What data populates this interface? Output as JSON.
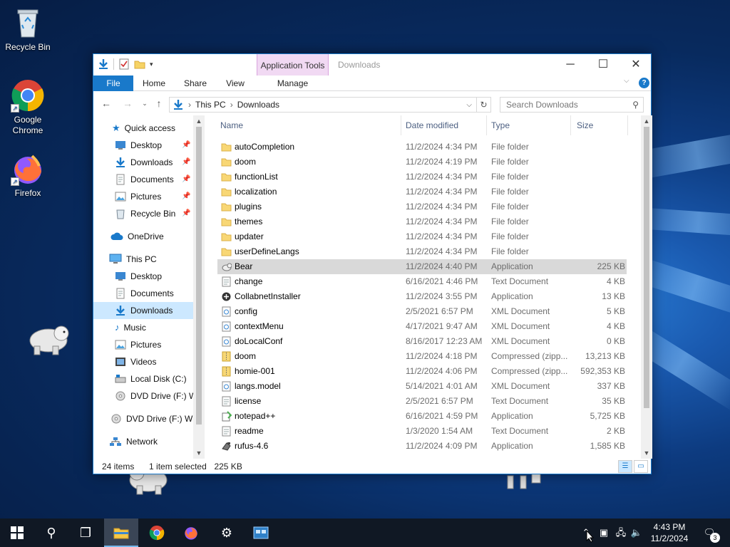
{
  "desktop": {
    "icons": [
      {
        "label": "Recycle Bin",
        "icon": "recycle-bin-icon"
      },
      {
        "label": "Google Chrome",
        "icon": "chrome-icon"
      },
      {
        "label": "Firefox",
        "icon": "firefox-icon"
      }
    ]
  },
  "window": {
    "title": "Downloads",
    "context_tab": "Application Tools",
    "ribbon_tabs": [
      "File",
      "Home",
      "Share",
      "View",
      "Manage"
    ],
    "breadcrumb": [
      "This PC",
      "Downloads"
    ],
    "search_placeholder": "Search Downloads",
    "accent": "#1979ca"
  },
  "nav": {
    "items": [
      {
        "label": "Quick access",
        "icon": "star-icon"
      },
      {
        "label": "Desktop",
        "icon": "desktop-folder-icon",
        "pinned": true
      },
      {
        "label": "Downloads",
        "icon": "download-arrow-icon",
        "pinned": true
      },
      {
        "label": "Documents",
        "icon": "documents-icon",
        "pinned": true
      },
      {
        "label": "Pictures",
        "icon": "pictures-icon",
        "pinned": true
      },
      {
        "label": "Recycle Bin",
        "icon": "recycle-bin-icon",
        "pinned": true
      },
      {
        "label": "OneDrive",
        "icon": "cloud-icon"
      },
      {
        "label": "This PC",
        "icon": "computer-icon"
      },
      {
        "label": "Desktop",
        "icon": "desktop-folder-icon"
      },
      {
        "label": "Documents",
        "icon": "documents-icon"
      },
      {
        "label": "Downloads",
        "icon": "download-arrow-icon",
        "selected": true
      },
      {
        "label": "Music",
        "icon": "music-icon"
      },
      {
        "label": "Pictures",
        "icon": "pictures-icon"
      },
      {
        "label": "Videos",
        "icon": "videos-icon"
      },
      {
        "label": "Local Disk (C:)",
        "icon": "disk-icon"
      },
      {
        "label": "DVD Drive (F:) W",
        "icon": "dvd-icon"
      },
      {
        "label": "DVD Drive (F:) WIN",
        "icon": "dvd-icon"
      },
      {
        "label": "Network",
        "icon": "network-icon"
      }
    ]
  },
  "columns": {
    "name": "Name",
    "date": "Date modified",
    "type": "Type",
    "size": "Size"
  },
  "files": [
    {
      "name": "autoCompletion",
      "date": "11/2/2024 4:34 PM",
      "type": "File folder",
      "size": "",
      "icon": "folder-icon"
    },
    {
      "name": "doom",
      "date": "11/2/2024 4:19 PM",
      "type": "File folder",
      "size": "",
      "icon": "folder-icon"
    },
    {
      "name": "functionList",
      "date": "11/2/2024 4:34 PM",
      "type": "File folder",
      "size": "",
      "icon": "folder-icon"
    },
    {
      "name": "localization",
      "date": "11/2/2024 4:34 PM",
      "type": "File folder",
      "size": "",
      "icon": "folder-icon"
    },
    {
      "name": "plugins",
      "date": "11/2/2024 4:34 PM",
      "type": "File folder",
      "size": "",
      "icon": "folder-icon"
    },
    {
      "name": "themes",
      "date": "11/2/2024 4:34 PM",
      "type": "File folder",
      "size": "",
      "icon": "folder-icon"
    },
    {
      "name": "updater",
      "date": "11/2/2024 4:34 PM",
      "type": "File folder",
      "size": "",
      "icon": "folder-icon"
    },
    {
      "name": "userDefineLangs",
      "date": "11/2/2024 4:34 PM",
      "type": "File folder",
      "size": "",
      "icon": "folder-icon"
    },
    {
      "name": "Bear",
      "date": "11/2/2024 4:40 PM",
      "type": "Application",
      "size": "225 KB",
      "icon": "bear-app-icon",
      "selected": true
    },
    {
      "name": "change",
      "date": "6/16/2021 4:46 PM",
      "type": "Text Document",
      "size": "4 KB",
      "icon": "text-file-icon"
    },
    {
      "name": "CollabnetInstaller",
      "date": "11/2/2024 3:55 PM",
      "type": "Application",
      "size": "13 KB",
      "icon": "installer-icon"
    },
    {
      "name": "config",
      "date": "2/5/2021 6:57 PM",
      "type": "XML Document",
      "size": "5 KB",
      "icon": "xml-file-icon"
    },
    {
      "name": "contextMenu",
      "date": "4/17/2021 9:47 AM",
      "type": "XML Document",
      "size": "4 KB",
      "icon": "xml-file-icon"
    },
    {
      "name": "doLocalConf",
      "date": "8/16/2017 12:23 AM",
      "type": "XML Document",
      "size": "0 KB",
      "icon": "xml-file-icon"
    },
    {
      "name": "doom",
      "date": "11/2/2024 4:18 PM",
      "type": "Compressed (zipp...",
      "size": "13,213 KB",
      "icon": "zip-icon"
    },
    {
      "name": "homie-001",
      "date": "11/2/2024 4:06 PM",
      "type": "Compressed (zipp...",
      "size": "592,353 KB",
      "icon": "zip-icon"
    },
    {
      "name": "langs.model",
      "date": "5/14/2021 4:01 AM",
      "type": "XML Document",
      "size": "337 KB",
      "icon": "xml-file-icon"
    },
    {
      "name": "license",
      "date": "2/5/2021 6:57 PM",
      "type": "Text Document",
      "size": "35 KB",
      "icon": "text-file-icon"
    },
    {
      "name": "notepad++",
      "date": "6/16/2021 4:59 PM",
      "type": "Application",
      "size": "5,725 KB",
      "icon": "notepadpp-icon"
    },
    {
      "name": "readme",
      "date": "1/3/2020 1:54 AM",
      "type": "Text Document",
      "size": "2 KB",
      "icon": "text-file-icon"
    },
    {
      "name": "rufus-4.6",
      "date": "11/2/2024 4:09 PM",
      "type": "Application",
      "size": "1,585 KB",
      "icon": "rufus-icon"
    }
  ],
  "status": {
    "count": "24 items",
    "selection": "1 item selected",
    "size": "225 KB"
  },
  "taskbar": {
    "buttons": [
      "start-icon",
      "search-icon",
      "task-view-icon",
      "file-explorer-icon",
      "chrome-icon",
      "firefox-icon",
      "settings-icon",
      "app-icon"
    ],
    "time": "4:43 PM",
    "date": "11/2/2024",
    "notification_count": "3"
  }
}
